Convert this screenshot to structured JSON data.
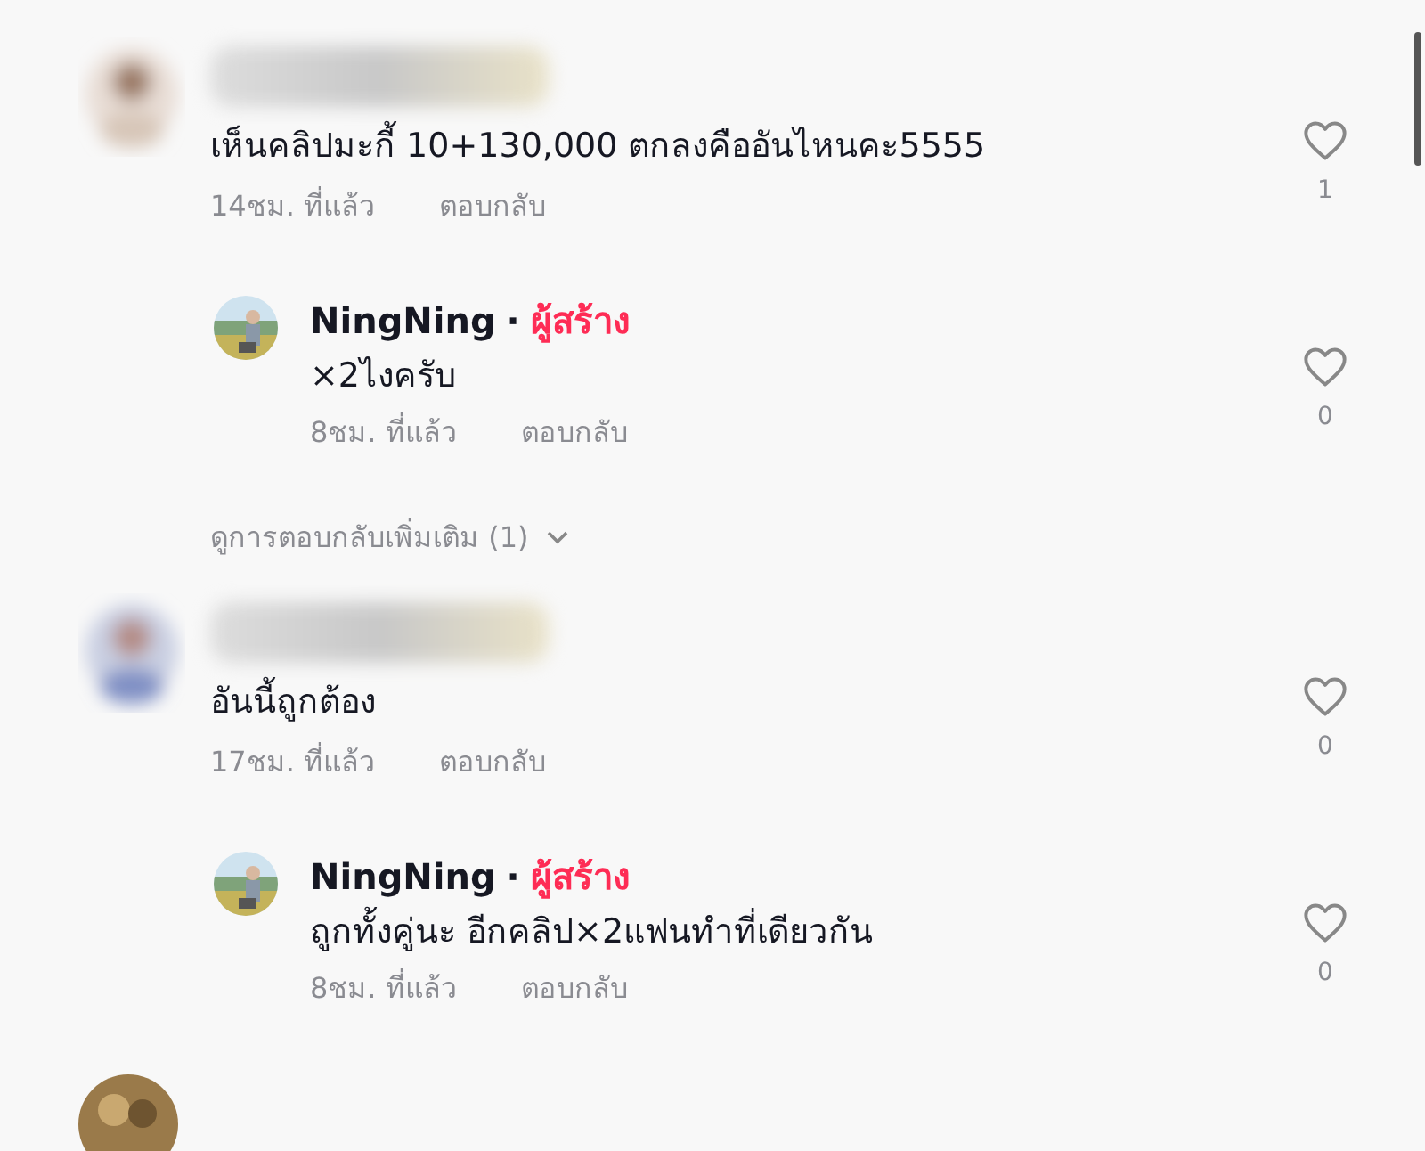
{
  "comments": [
    {
      "text": "เห็นคลิปมะกี้ 10+130,000 ตกลงคืออันไหนคะ5555",
      "time": "14ชม. ที่แล้ว",
      "reply_label": "ตอบกลับ",
      "likes": "1",
      "replies": [
        {
          "name": "NingNing",
          "separator": "·",
          "badge": "ผู้สร้าง",
          "text": "×2ไงครับ",
          "time": "8ชม. ที่แล้ว",
          "reply_label": "ตอบกลับ",
          "likes": "0"
        }
      ],
      "more_replies": "ดูการตอบกลับเพิ่มเติม (1)"
    },
    {
      "text": "อันนี้ถูกต้อง",
      "time": "17ชม. ที่แล้ว",
      "reply_label": "ตอบกลับ",
      "likes": "0",
      "replies": [
        {
          "name": "NingNing",
          "separator": "·",
          "badge": "ผู้สร้าง",
          "text": "ถูกทั้งคู่นะ อีกคลิป×2แฟนทำที่เดียวกัน",
          "time": "8ชม. ที่แล้ว",
          "reply_label": "ตอบกลับ",
          "likes": "0"
        }
      ]
    }
  ]
}
